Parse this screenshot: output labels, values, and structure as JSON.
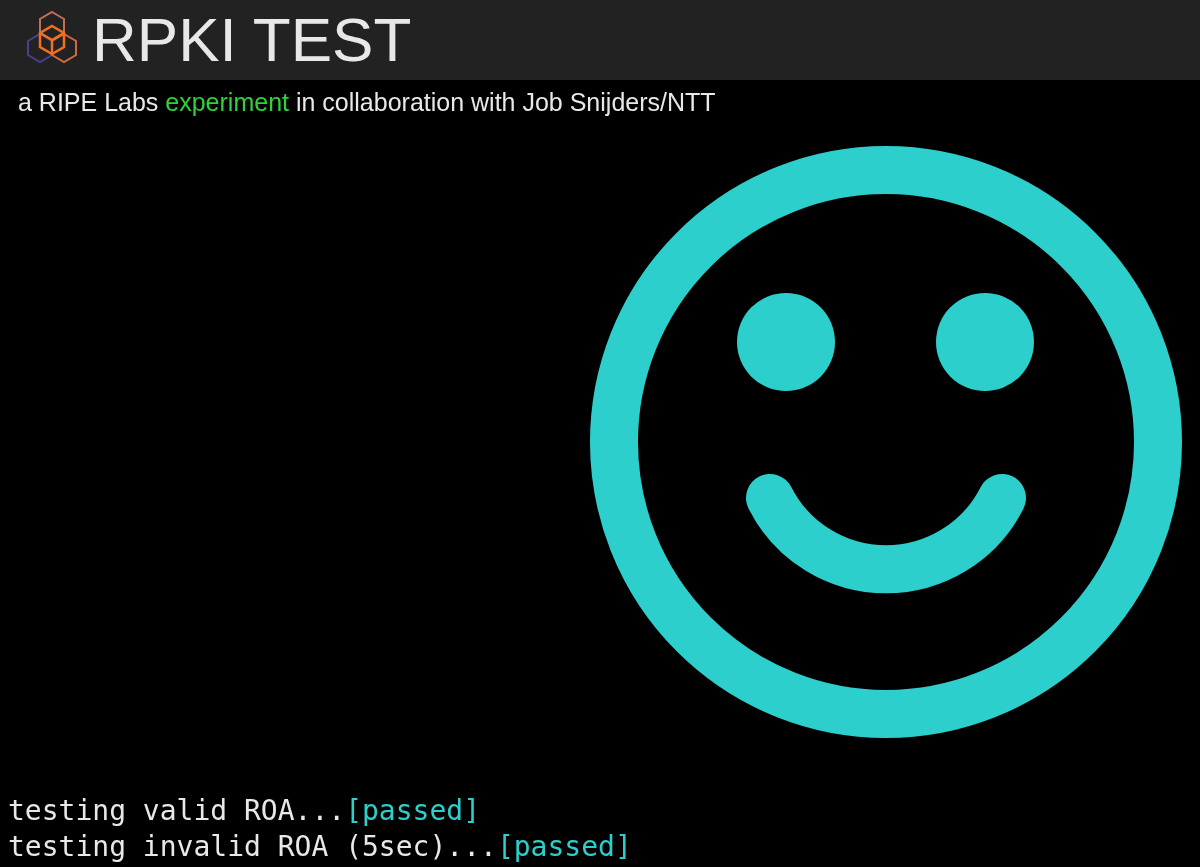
{
  "header": {
    "title": "RPKI TEST"
  },
  "subtitle": {
    "before": "a RIPE Labs ",
    "highlight": "experiment",
    "after": " in collaboration with Job Snijders/NTT"
  },
  "tests": [
    {
      "label": "testing valid ROA...",
      "result": "[passed]"
    },
    {
      "label": "testing invalid ROA (5sec)...",
      "result": "[passed]"
    }
  ]
}
